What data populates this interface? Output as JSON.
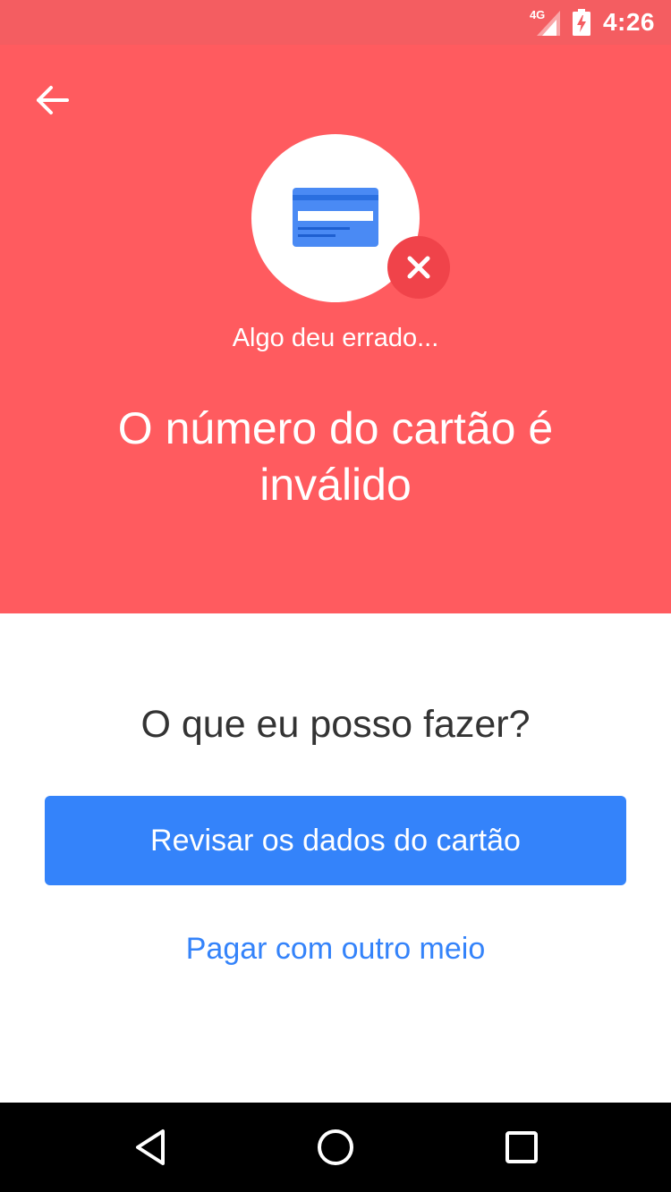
{
  "status_bar": {
    "network_label": "4G",
    "time": "4:26",
    "icons": [
      "signal-icon",
      "battery-charging-icon"
    ]
  },
  "header": {
    "back_icon": "arrow-back-icon",
    "illustration_icon": "credit-card-icon",
    "badge_icon": "close-icon",
    "subtitle": "Algo deu errado...",
    "title": "O número do cartão é inválido"
  },
  "main": {
    "question": "O que eu posso fazer?",
    "primary_button_label": "Revisar os dados do cartão",
    "secondary_link_label": "Pagar com outro meio"
  },
  "nav_bar": {
    "icons": [
      "back-triangle-icon",
      "home-circle-icon",
      "recents-square-icon"
    ]
  },
  "colors": {
    "header_bg": "#ff5b5f",
    "status_bar_bg": "#f45d61",
    "badge_bg": "#f0434a",
    "accent_blue": "#3483fa",
    "card_blue": "#4a8af4",
    "text_dark": "#333333"
  }
}
